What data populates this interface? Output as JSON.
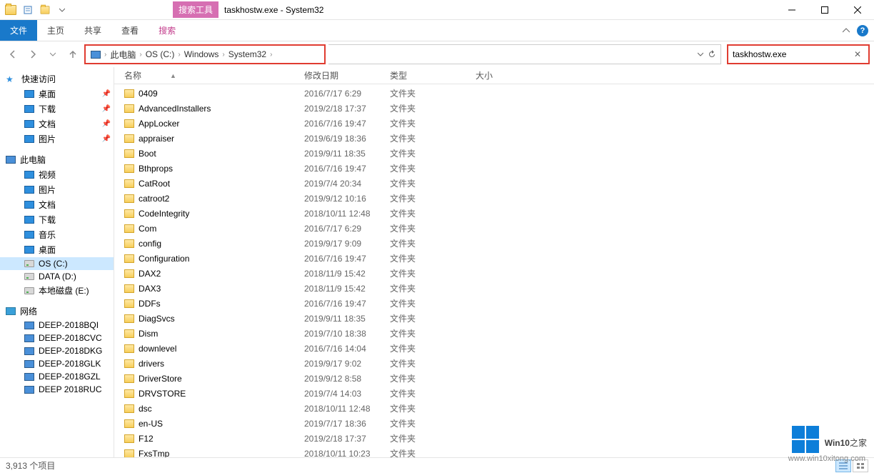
{
  "window": {
    "search_tools_label": "搜索工具",
    "title": "taskhostw.exe - System32"
  },
  "ribbon": {
    "file": "文件",
    "tabs": [
      "主页",
      "共享",
      "查看",
      "搜索"
    ]
  },
  "breadcrumb": {
    "segments": [
      "此电脑",
      "OS (C:)",
      "Windows",
      "System32"
    ]
  },
  "search": {
    "value": "taskhostw.exe"
  },
  "sidebar": {
    "quick_access": {
      "label": "快速访问",
      "items": [
        {
          "label": "桌面",
          "icon": "desktop",
          "pinned": true
        },
        {
          "label": "下载",
          "icon": "download",
          "pinned": true
        },
        {
          "label": "文档",
          "icon": "document",
          "pinned": true
        },
        {
          "label": "图片",
          "icon": "picture",
          "pinned": true
        }
      ]
    },
    "this_pc": {
      "label": "此电脑",
      "items": [
        {
          "label": "视频",
          "icon": "video"
        },
        {
          "label": "图片",
          "icon": "picture"
        },
        {
          "label": "文档",
          "icon": "document"
        },
        {
          "label": "下载",
          "icon": "download"
        },
        {
          "label": "音乐",
          "icon": "music"
        },
        {
          "label": "桌面",
          "icon": "desktop"
        },
        {
          "label": "OS (C:)",
          "icon": "drive",
          "selected": true
        },
        {
          "label": "DATA (D:)",
          "icon": "drive"
        },
        {
          "label": "本地磁盘 (E:)",
          "icon": "drive"
        }
      ]
    },
    "network": {
      "label": "网络",
      "items": [
        {
          "label": "DEEP-2018BQI"
        },
        {
          "label": "DEEP-2018CVC"
        },
        {
          "label": "DEEP-2018DKG"
        },
        {
          "label": "DEEP-2018GLK"
        },
        {
          "label": "DEEP-2018GZL"
        },
        {
          "label": "DEEP 2018RUC"
        }
      ]
    }
  },
  "columns": {
    "name": "名称",
    "date": "修改日期",
    "type": "类型",
    "size": "大小"
  },
  "type_folder": "文件夹",
  "files": [
    {
      "name": "0409",
      "date": "2016/7/17 6:29"
    },
    {
      "name": "AdvancedInstallers",
      "date": "2019/2/18 17:37"
    },
    {
      "name": "AppLocker",
      "date": "2016/7/16 19:47"
    },
    {
      "name": "appraiser",
      "date": "2019/6/19 18:36"
    },
    {
      "name": "Boot",
      "date": "2019/9/11 18:35"
    },
    {
      "name": "Bthprops",
      "date": "2016/7/16 19:47"
    },
    {
      "name": "CatRoot",
      "date": "2019/7/4 20:34"
    },
    {
      "name": "catroot2",
      "date": "2019/9/12 10:16"
    },
    {
      "name": "CodeIntegrity",
      "date": "2018/10/11 12:48"
    },
    {
      "name": "Com",
      "date": "2016/7/17 6:29"
    },
    {
      "name": "config",
      "date": "2019/9/17 9:09"
    },
    {
      "name": "Configuration",
      "date": "2016/7/16 19:47"
    },
    {
      "name": "DAX2",
      "date": "2018/11/9 15:42"
    },
    {
      "name": "DAX3",
      "date": "2018/11/9 15:42"
    },
    {
      "name": "DDFs",
      "date": "2016/7/16 19:47"
    },
    {
      "name": "DiagSvcs",
      "date": "2019/9/11 18:35"
    },
    {
      "name": "Dism",
      "date": "2019/7/10 18:38"
    },
    {
      "name": "downlevel",
      "date": "2016/7/16 14:04"
    },
    {
      "name": "drivers",
      "date": "2019/9/17 9:02"
    },
    {
      "name": "DriverStore",
      "date": "2019/9/12 8:58"
    },
    {
      "name": "DRVSTORE",
      "date": "2019/7/4 14:03"
    },
    {
      "name": "dsc",
      "date": "2018/10/11 12:48"
    },
    {
      "name": "en-US",
      "date": "2019/7/17 18:36"
    },
    {
      "name": "F12",
      "date": "2019/2/18 17:37"
    },
    {
      "name": "FxsTmp",
      "date": "2018/10/11 10:23"
    }
  ],
  "status": {
    "count_label": "3,913 个项目"
  },
  "watermark": {
    "text_a": "Win10",
    "text_b": "之家",
    "url": "www.win10xitong.com"
  }
}
